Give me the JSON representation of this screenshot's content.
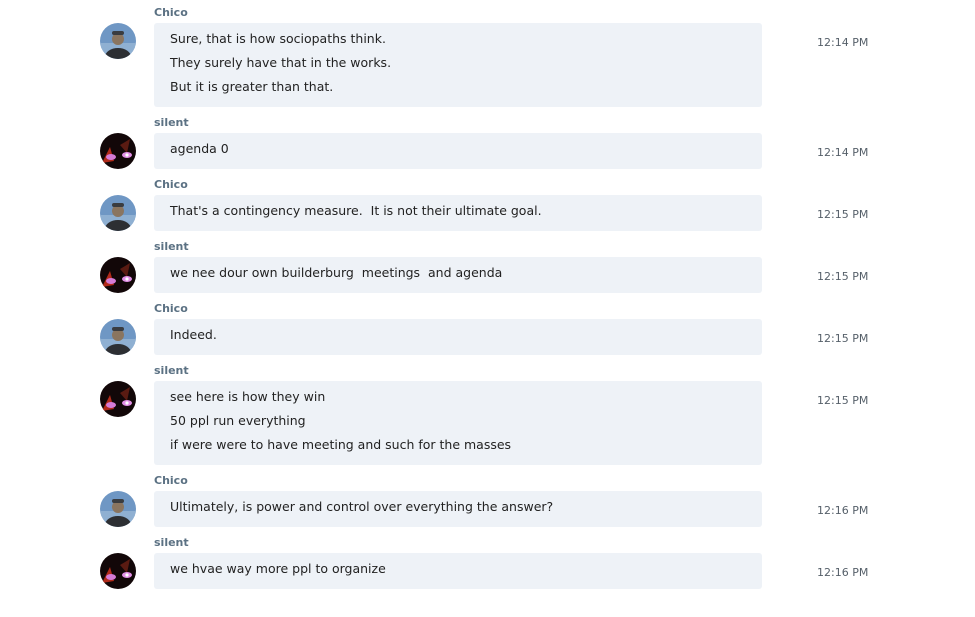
{
  "messages": [
    {
      "author": "Chico",
      "avatar": "chico",
      "time": "12:14 PM",
      "lines": [
        "Sure, that is how sociopaths think.",
        "They surely have that in the works.",
        "But it is greater than that."
      ]
    },
    {
      "author": "silent",
      "avatar": "silent",
      "time": "12:14 PM",
      "lines": [
        "agenda 0"
      ]
    },
    {
      "author": "Chico",
      "avatar": "chico",
      "time": "12:15 PM",
      "lines": [
        "That's a contingency measure.  It is not their ultimate goal."
      ]
    },
    {
      "author": "silent",
      "avatar": "silent",
      "time": "12:15 PM",
      "lines": [
        "we nee dour own builderburg  meetings  and agenda"
      ]
    },
    {
      "author": "Chico",
      "avatar": "chico",
      "time": "12:15 PM",
      "lines": [
        "Indeed."
      ]
    },
    {
      "author": "silent",
      "avatar": "silent",
      "time": "12:15 PM",
      "lines": [
        "see here is how they win",
        "50 ppl run everything",
        "if were were to have meeting and such for the masses"
      ]
    },
    {
      "author": "Chico",
      "avatar": "chico",
      "time": "12:16 PM",
      "lines": [
        "Ultimately, is power and control over everything the answer?"
      ]
    },
    {
      "author": "silent",
      "avatar": "silent",
      "time": "12:16 PM",
      "lines": [
        "we hvae way more ppl to organize"
      ]
    }
  ]
}
